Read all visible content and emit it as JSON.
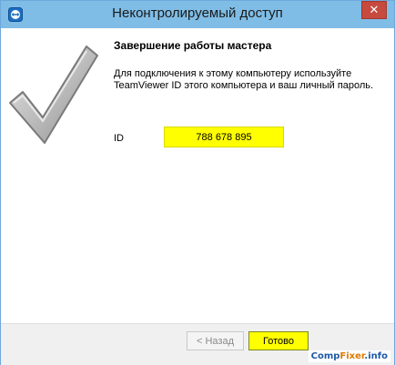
{
  "window": {
    "title": "Неконтролируемый доступ",
    "close_symbol": "✕",
    "icon": "teamviewer-icon"
  },
  "main": {
    "heading": "Завершение работы мастера",
    "description": "Для подключения к этому компьютеру используйте TeamViewer ID этого компьютера и ваш личный пароль.",
    "id_label": "ID",
    "id_value": "788 678 895",
    "decoration": "check-mark-icon"
  },
  "footer": {
    "back_label": "< Назад",
    "finish_label": "Готово"
  },
  "watermark": {
    "prefix": "Comp",
    "accent": "Fixer",
    "suffix": ".info"
  },
  "colors": {
    "titlebar": "#7fbde6",
    "close_button": "#c74a3e",
    "highlight": "#ffff00"
  }
}
